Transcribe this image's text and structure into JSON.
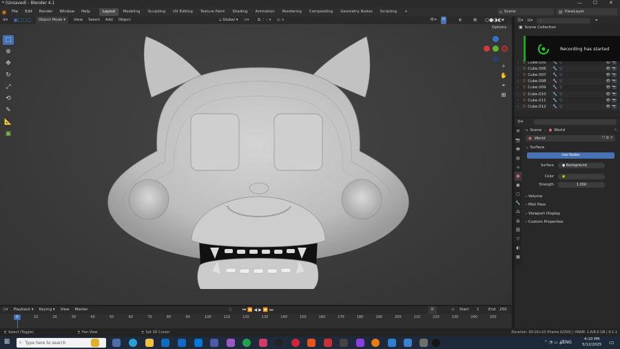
{
  "window": {
    "title": "* (Unsaved) - Blender 4.1"
  },
  "menubar": {
    "items": [
      "File",
      "Edit",
      "Render",
      "Window",
      "Help"
    ],
    "workspaces": [
      "Layout",
      "Modeling",
      "Sculpting",
      "UV Editing",
      "Texture Paint",
      "Shading",
      "Animation",
      "Rendering",
      "Compositing",
      "Geometry Nodes",
      "Scripting"
    ],
    "active_workspace": "Layout",
    "add_tab": "+",
    "scene": "Scene",
    "view_layer": "ViewLayer"
  },
  "viewport_header": {
    "mode": "Object Mode",
    "menus": [
      "View",
      "Select",
      "Add",
      "Object"
    ],
    "orientation": "Global",
    "options": "Options"
  },
  "toolbar": {
    "tools": [
      "select-box",
      "cursor",
      "move",
      "rotate",
      "scale",
      "transform",
      "annotate",
      "measure",
      "add-cube"
    ],
    "active": "select-box"
  },
  "outliner": {
    "search_placeholder": "",
    "root": "Scene Collection",
    "items": [
      "Cube.005",
      "Cube.006",
      "Cube.007",
      "Cube.008",
      "Cube.009",
      "Cube.010",
      "Cube.011",
      "Cube.012"
    ]
  },
  "notification": {
    "text": "Recording has started"
  },
  "properties": {
    "breadcrumb_scene": "Scene",
    "breadcrumb_world": "World",
    "datablock": "World",
    "panel_surface": "Surface",
    "use_nodes": "Use Nodes",
    "surface_label": "Surface",
    "surface_value": "Background",
    "color_label": "Color",
    "strength_label": "Strength",
    "strength_value": "1.000",
    "collapsed_panels": [
      "Volume",
      "Mist Pass",
      "Viewport Display",
      "Custom Properties"
    ]
  },
  "timeline": {
    "menus": [
      "Playback",
      "Keying",
      "View",
      "Marker"
    ],
    "current_frame": "0",
    "start_label": "Start",
    "start_value": "1",
    "end_label": "End",
    "end_value": "250",
    "ticks": [
      "0",
      "10",
      "20",
      "30",
      "40",
      "50",
      "60",
      "70",
      "80",
      "90",
      "100",
      "110",
      "120",
      "130",
      "140",
      "150",
      "160",
      "170",
      "180",
      "190",
      "200",
      "210",
      "220",
      "230",
      "240",
      "250"
    ],
    "playhead_label": "0"
  },
  "statusbar": {
    "left": "Select (Toggle)",
    "middle": "Pan View",
    "right_hint": "Set 3D Cursor",
    "stats": "Duration: 00:10+10 (Frame 0/250) | VRAM: 1.6/8.0 GB | 4.1.1"
  },
  "taskbar": {
    "search_placeholder": "Type here to search",
    "lang": "ENG",
    "time": "4:10 PM",
    "date": "5/12/2025"
  },
  "colors": {
    "accent": "#4772b3",
    "notify_green": "#1fa21f",
    "bg": "#3d3d3d"
  }
}
